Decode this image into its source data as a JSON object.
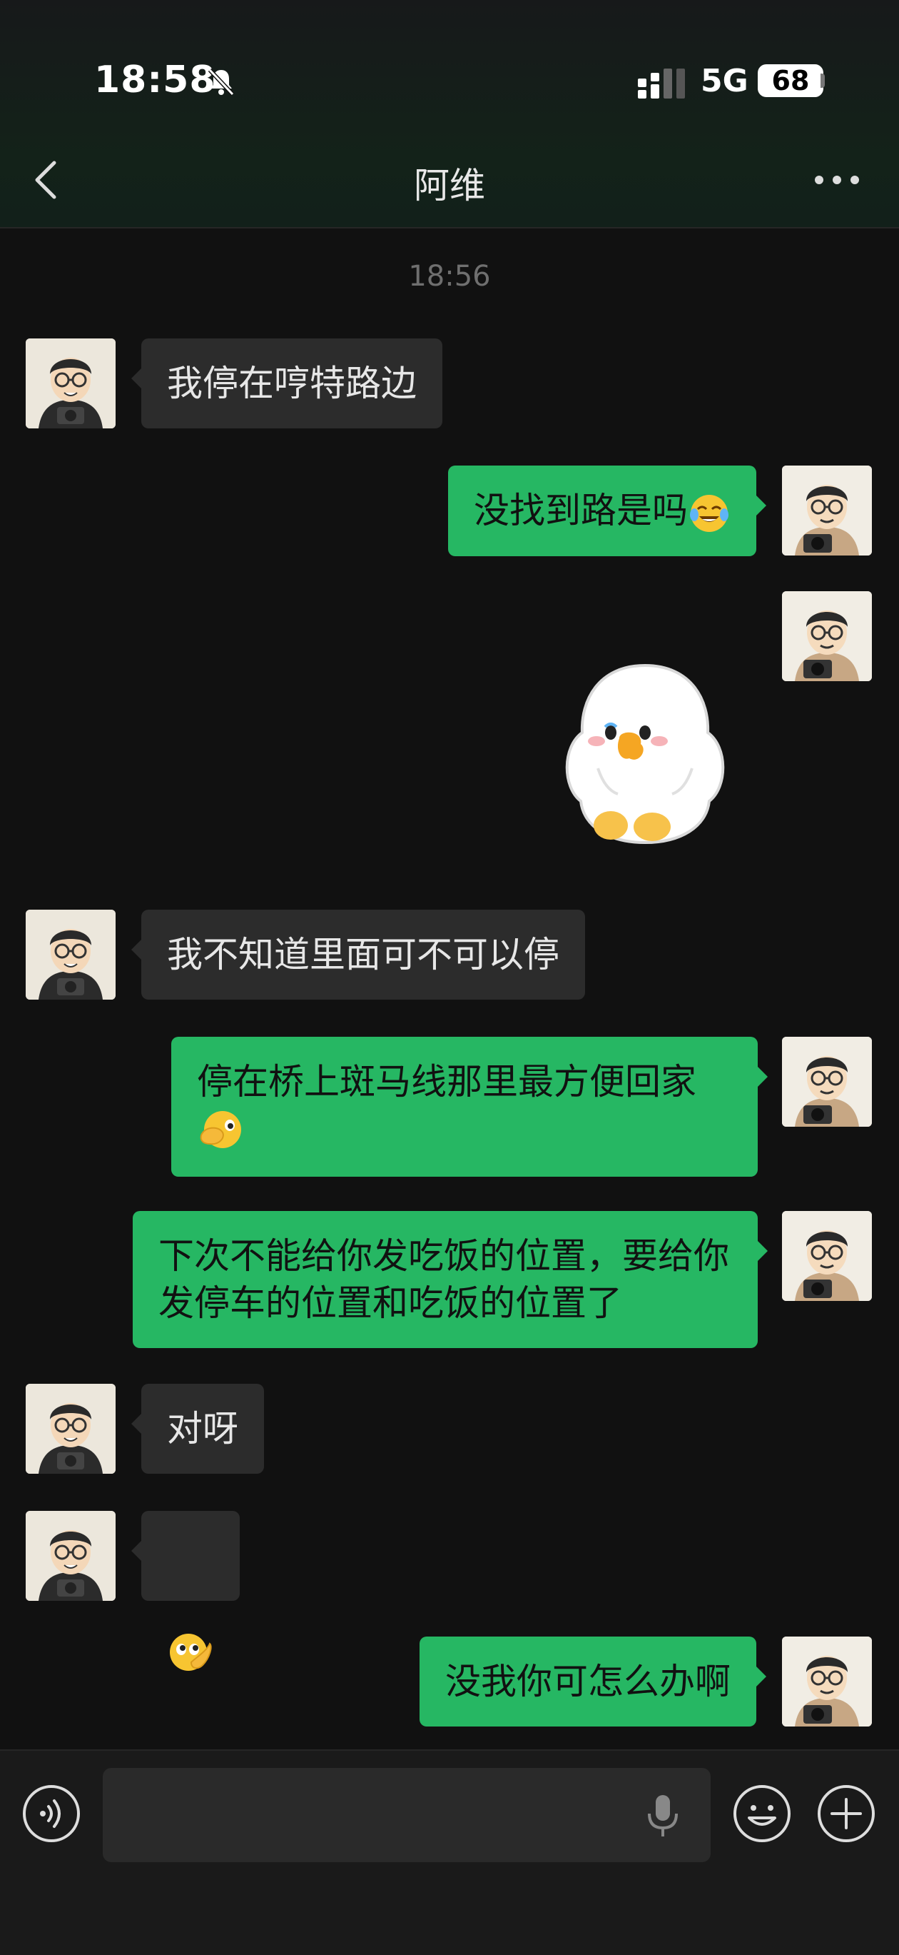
{
  "status_bar": {
    "time": "18:58",
    "network": "5G",
    "battery": "68"
  },
  "header": {
    "title": "阿维"
  },
  "chat": {
    "timestamp": "18:56",
    "messages": [
      {
        "side": "in",
        "text": "我停在哼特路边"
      },
      {
        "side": "out",
        "text": "没找到路是吗",
        "emoji": "tears-of-joy"
      },
      {
        "side": "out",
        "type": "sticker",
        "sticker": "white-duck-sticker"
      },
      {
        "side": "in",
        "text": "我不知道里面可不可以停"
      },
      {
        "side": "out",
        "text": "停在桥上斑马线那里最方便回家",
        "emoji": "face-with-hand-over-mouth"
      },
      {
        "side": "out",
        "text": "下次不能给你发吃饭的位置，要给你发停车的位置和吃饭的位置了"
      },
      {
        "side": "in",
        "text": "对呀"
      },
      {
        "side": "in",
        "type": "emoji",
        "emoji": "pondering-face"
      },
      {
        "side": "out",
        "text": "没我你可怎么办啊"
      }
    ]
  },
  "input_bar": {
    "placeholder": ""
  },
  "colors": {
    "out_bubble": "#26b763",
    "in_bubble": "#2c2c2c",
    "background": "#111111"
  }
}
